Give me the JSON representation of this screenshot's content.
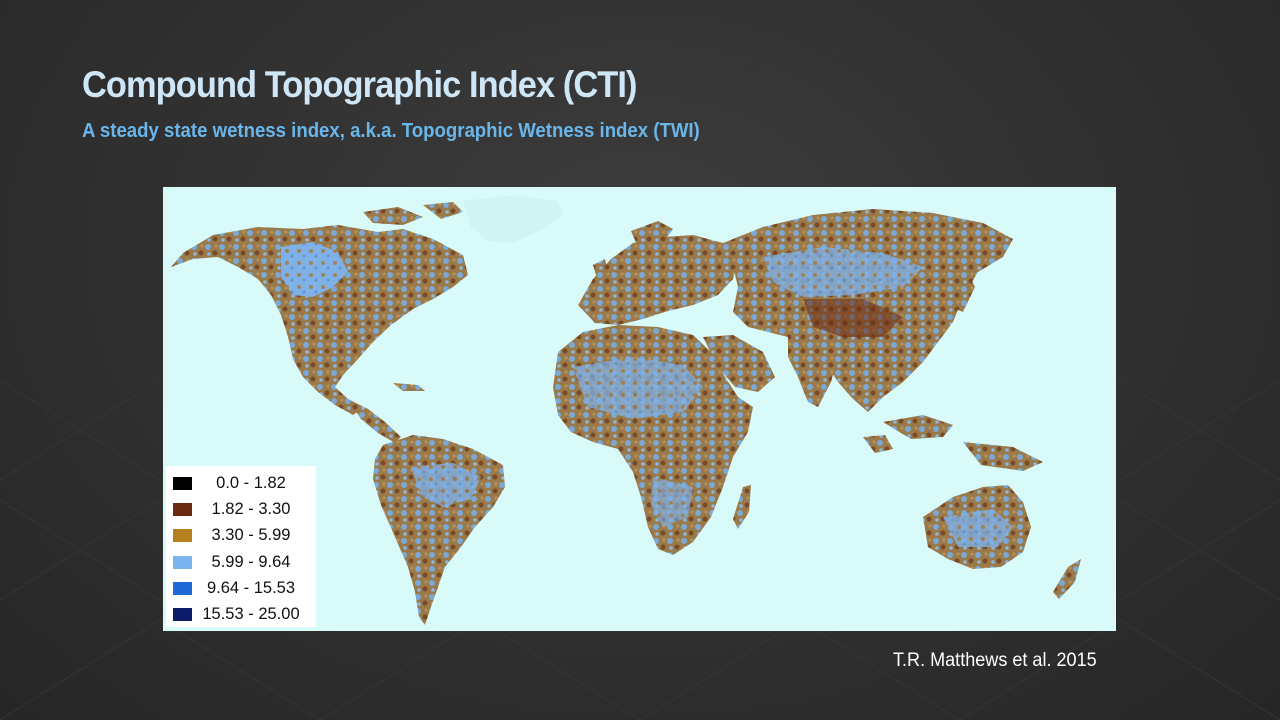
{
  "slide": {
    "title": "Compound Topographic Index (CTI)",
    "subtitle": "A steady state wetness index, a.k.a. Topographic Wetness index (TWI)",
    "citation": "T.R. Matthews et al. 2015"
  },
  "map": {
    "ocean_color": "#d8fbfa",
    "legend": [
      {
        "label": "0.0 - 1.82",
        "color": "#000000"
      },
      {
        "label": "1.82 - 3.30",
        "color": "#6b2a12"
      },
      {
        "label": "3.30 - 5.99",
        "color": "#b5801d"
      },
      {
        "label": "5.99 - 9.64",
        "color": "#7ab3ee"
      },
      {
        "label": "9.64 - 15.53",
        "color": "#1f68d8"
      },
      {
        "label": "15.53 - 25.00",
        "color": "#0d1b6b"
      }
    ]
  },
  "colors": {
    "title": "#cfe6f7",
    "subtitle": "#6ab6ea",
    "background": "#303030"
  }
}
